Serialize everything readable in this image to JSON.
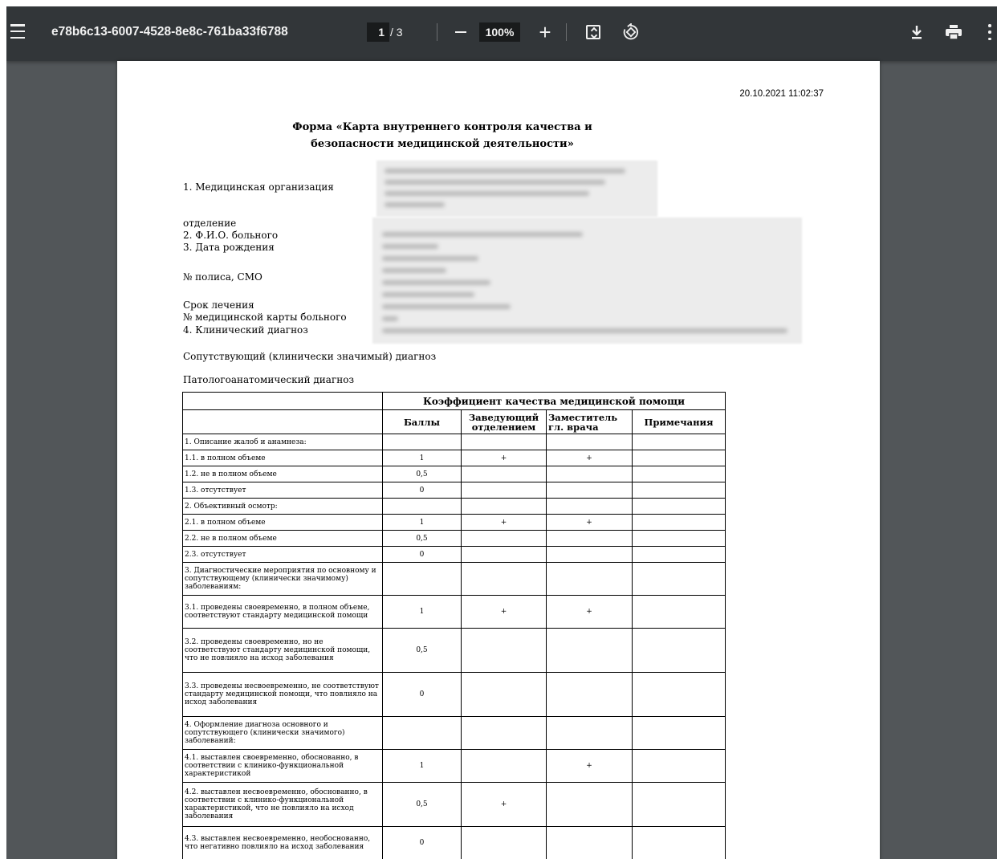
{
  "toolbar": {
    "doc_title": "e78b6c13-6007-4528-8e8c-761ba33f6788",
    "page_current": "1",
    "page_total_label": "/ 3",
    "zoom": "100%",
    "zoom_in_label": "+"
  },
  "document": {
    "timestamp": "20.10.2021 11:02:37",
    "title_line1": "Форма «Карта внутреннего контроля качества и",
    "title_line2": "безопасности медицинской деятельности»",
    "fields": {
      "org": "1. Медицинская организация",
      "dept": "отделение",
      "fio": "2. Ф.И.О. больного",
      "dob": "3. Дата рождения",
      "polis": "№ полиса, СМО",
      "term": "Срок лечения",
      "card": "№ медицинской карты больного",
      "diag": "4. Клинический диагноз",
      "concomitant": "Сопутствующий (клинически значимый) диагноз",
      "patho": "Патологоанатомический диагноз"
    },
    "table": {
      "header_main": "Коэффициент качества медицинской помощи",
      "col_score": "Баллы",
      "col_head_line1": "Заведующий",
      "col_head_line2": "отделением",
      "col_deputy_line1": "Заместитель",
      "col_deputy_line2": "гл. врача",
      "col_notes": "Примечания",
      "rows": [
        {
          "label": "1. Описание жалоб и анамнеза:",
          "score": "",
          "head": "",
          "deputy": "",
          "notes": ""
        },
        {
          "label": "1.1. в полном объеме",
          "score": "1",
          "head": "+",
          "deputy": "+",
          "notes": ""
        },
        {
          "label": "1.2. не в полном объеме",
          "score": "0,5",
          "head": "",
          "deputy": "",
          "notes": ""
        },
        {
          "label": "1.3. отсутствует",
          "score": "0",
          "head": "",
          "deputy": "",
          "notes": ""
        },
        {
          "label": "2. Объективный осмотр:",
          "score": "",
          "head": "",
          "deputy": "",
          "notes": ""
        },
        {
          "label": "2.1. в полном объеме",
          "score": "1",
          "head": "+",
          "deputy": "+",
          "notes": ""
        },
        {
          "label": "2.2. не в полном объеме",
          "score": "0,5",
          "head": "",
          "deputy": "",
          "notes": ""
        },
        {
          "label": "2.3. отсутствует",
          "score": "0",
          "head": "",
          "deputy": "",
          "notes": ""
        },
        {
          "label": "3. Диагностические мероприятия по основному и сопутствующему (клинически значимому) заболеваниям:",
          "score": "",
          "head": "",
          "deputy": "",
          "notes": ""
        },
        {
          "label": "3.1. проведены своевременно, в полном объеме, соответствуют стандарту медицинской помощи",
          "score": "1",
          "head": "+",
          "deputy": "+",
          "notes": ""
        },
        {
          "label": "3.2. проведены своевременно, но не соответствуют стандарту медицинской помощи, что не повлияло на исход заболевания",
          "score": "0,5",
          "head": "",
          "deputy": "",
          "notes": ""
        },
        {
          "label": "3.3. проведены   несвоевременно, не соответствуют стандарту медицинской помощи, что повлияло на исход заболевания",
          "score": "0",
          "head": "",
          "deputy": "",
          "notes": ""
        },
        {
          "label": "4. Оформление диагноза основного и сопутствующего (клинически значимого) заболеваний:",
          "score": "",
          "head": "",
          "deputy": "",
          "notes": ""
        },
        {
          "label": "4.1. выставлен своевременно, обоснованно, в соответствии с клинико-функциональной характеристикой",
          "score": "1",
          "head": "",
          "deputy": "+",
          "notes": ""
        },
        {
          "label": "4.2. выставлен несвоевременно, обоснованно, в соответствии с клинико-функциональной характеристикой, что не повлияло на исход заболевания",
          "score": "0,5",
          "head": "+",
          "deputy": "",
          "notes": ""
        },
        {
          "label": "4.3. выставлен несвоевременно, необоснованно, что негативно повлияло на исход заболевания",
          "score": "0",
          "head": "",
          "deputy": "",
          "notes": ""
        }
      ]
    }
  }
}
